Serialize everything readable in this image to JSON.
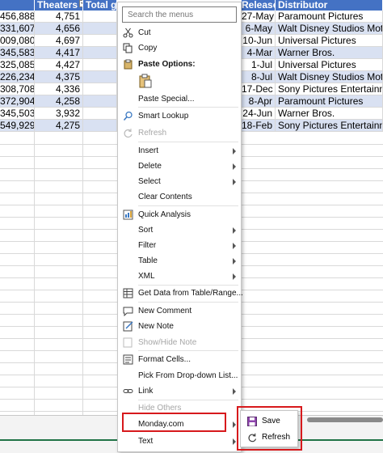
{
  "sheet": {
    "headers": [
      "Theaters",
      "Total gro",
      "Release",
      "Distributor"
    ],
    "rows": [
      {
        "gross": "456,888",
        "theaters": "4,751",
        "release": "27-May",
        "distributor": "Paramount Pictures"
      },
      {
        "gross": "331,607",
        "theaters": "4,656",
        "release": "6-May",
        "distributor": "Walt Disney Studios Motion"
      },
      {
        "gross": "009,080",
        "theaters": "4,697",
        "release": "10-Jun",
        "distributor": "Universal Pictures"
      },
      {
        "gross": "345,583",
        "theaters": "4,417",
        "release": "4-Mar",
        "distributor": "Warner Bros."
      },
      {
        "gross": "325,085",
        "theaters": "4,427",
        "release": "1-Jul",
        "distributor": "Universal Pictures"
      },
      {
        "gross": "226,234",
        "theaters": "4,375",
        "release": "8-Jul",
        "distributor": "Walt Disney Studios Motion"
      },
      {
        "gross": "308,708",
        "theaters": "4,336",
        "release": "17-Dec",
        "distributor": "Sony Pictures Entertainment"
      },
      {
        "gross": "372,904",
        "theaters": "4,258",
        "release": "8-Apr",
        "distributor": "Paramount Pictures"
      },
      {
        "gross": "345,503",
        "theaters": "3,932",
        "release": "24-Jun",
        "distributor": "Warner Bros."
      },
      {
        "gross": "549,929",
        "theaters": "4,275",
        "release": "18-Feb",
        "distributor": "Sony Pictures Entertainment"
      }
    ]
  },
  "menu": {
    "search_placeholder": "Search the menus",
    "cut": "Cut",
    "copy": "Copy",
    "paste_options": "Paste Options:",
    "paste_special": "Paste Special...",
    "smart_lookup": "Smart Lookup",
    "refresh": "Refresh",
    "insert": "Insert",
    "delete": "Delete",
    "select": "Select",
    "clear_contents": "Clear Contents",
    "quick_analysis": "Quick Analysis",
    "sort": "Sort",
    "filter": "Filter",
    "table": "Table",
    "xml": "XML",
    "get_data": "Get Data from Table/Range...",
    "new_comment": "New Comment",
    "new_note": "New Note",
    "show_hide_note": "Show/Hide Note",
    "format_cells": "Format Cells...",
    "pick_dropdown": "Pick From Drop-down List...",
    "link": "Link",
    "hide_others": "Hide Others",
    "monday": "Monday.com",
    "text": "Text"
  },
  "submenu": {
    "save": "Save",
    "refresh": "Refresh"
  },
  "colors": {
    "header_blue": "#4472c4",
    "band_blue": "#d9e1f2",
    "highlight_red": "#d7191c"
  }
}
